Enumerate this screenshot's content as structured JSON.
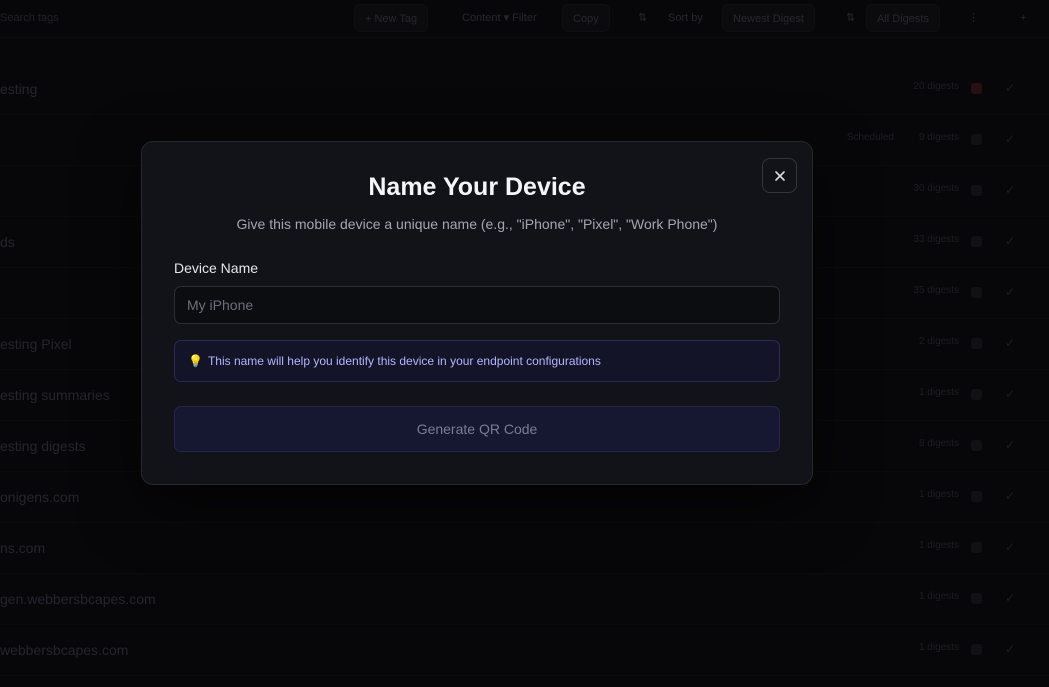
{
  "background": {
    "search_placeholder": "Search tags",
    "toolbar": [
      "+ New Tag",
      "Content ▾ Filter",
      "Copy",
      "⇅",
      "Sort by",
      "Newest Digest",
      "⇅",
      "All Digests",
      "⋮",
      "+"
    ],
    "rows": [
      {
        "title": "esting",
        "badge": "",
        "count": "20 digests",
        "alert": true
      },
      {
        "title": "",
        "badge": "Scheduled",
        "count": "9 digests",
        "alert": false
      },
      {
        "title": "",
        "badge": "",
        "count": "30 digests",
        "alert": false
      },
      {
        "title": "ds",
        "badge": "",
        "count": "33 digests",
        "alert": false
      },
      {
        "title": "",
        "badge": "",
        "count": "35 digests",
        "alert": false
      },
      {
        "title": "esting Pixel",
        "badge": "",
        "count": "2 digests",
        "alert": false
      },
      {
        "title": "esting summaries",
        "badge": "",
        "count": "1 digests",
        "alert": false
      },
      {
        "title": "esting digests",
        "badge": "",
        "count": "8 digests",
        "alert": false
      },
      {
        "title": "onigens.com",
        "badge": "",
        "count": "1 digests",
        "alert": false
      },
      {
        "title": "ns.com",
        "badge": "",
        "count": "1 digests",
        "alert": false
      },
      {
        "title": "gen.webbersbcapes.com",
        "badge": "",
        "count": "1 digests",
        "alert": false
      },
      {
        "title": "webbersbcapes.com",
        "badge": "",
        "count": "1 digests",
        "alert": false
      }
    ]
  },
  "modal": {
    "title": "Name Your Device",
    "subtitle": "Give this mobile device a unique name (e.g., \"iPhone\", \"Pixel\", \"Work Phone\")",
    "field_label": "Device Name",
    "input_value": "",
    "input_placeholder": "My iPhone",
    "info_icon": "lightbulb-icon",
    "info_icon_glyph": "💡",
    "info_text": "This name will help you identify this device in your endpoint configurations",
    "button_label": "Generate QR Code",
    "close_icon": "close-icon"
  },
  "colors": {
    "backdrop": "#0b0b0e",
    "modal_bg": "#121319",
    "accent_info_bg": "#141428",
    "accent_info_text": "#b2b5ff",
    "button_bg": "#161730"
  }
}
